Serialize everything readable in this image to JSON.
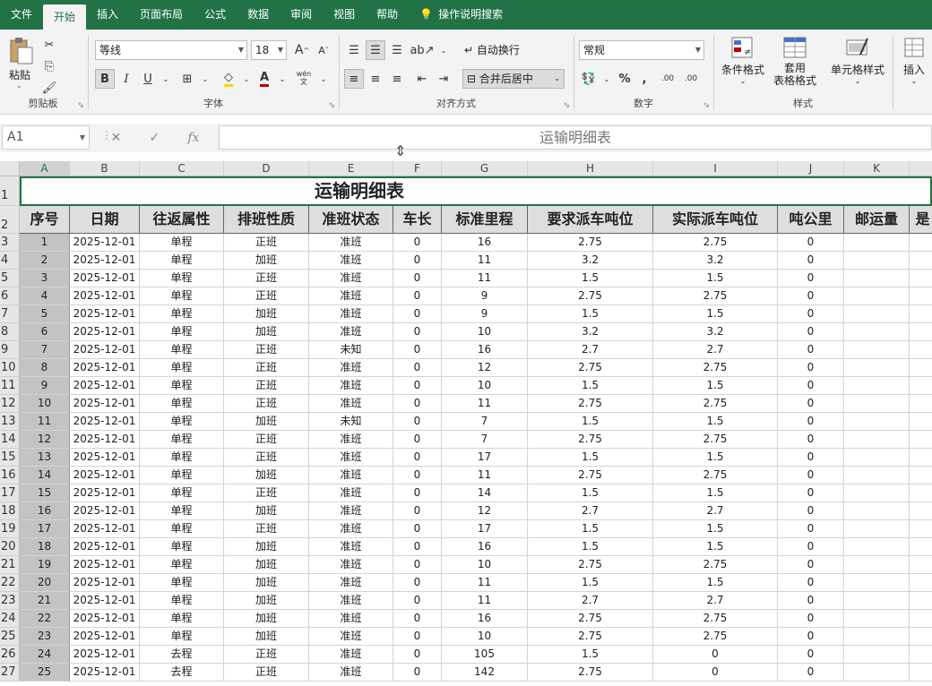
{
  "tabs": [
    "文件",
    "开始",
    "插入",
    "页面布局",
    "公式",
    "数据",
    "审阅",
    "视图",
    "帮助"
  ],
  "active_tab": "开始",
  "tell_me": "操作说明搜索",
  "ribbon": {
    "clipboard": {
      "paste": "粘贴",
      "label": "剪贴板"
    },
    "font": {
      "name": "等线",
      "size": "18",
      "label": "字体",
      "bold": "B",
      "italic": "I",
      "underline": "U",
      "grow": "A",
      "shrink": "A",
      "phonetic": "wén\n文"
    },
    "align": {
      "wrap": "自动换行",
      "merge": "合并后居中",
      "label": "对齐方式"
    },
    "number": {
      "format": "常规",
      "label": "数字",
      "dec_inc": ".00",
      "dec_dec": ".00"
    },
    "styles": {
      "conditional": "条件格式",
      "table_l1": "套用",
      "table_l2": "表格格式",
      "cell": "单元格样式",
      "label": "样式"
    },
    "cells": {
      "insert": "插入"
    }
  },
  "formula_bar": {
    "name_box": "A1",
    "fx": "fx",
    "content": "运输明细表"
  },
  "columns": [
    "A",
    "B",
    "C",
    "D",
    "E",
    "F",
    "G",
    "H",
    "I",
    "J",
    "K"
  ],
  "row_numbers": [
    "1",
    "2",
    "3",
    "4",
    "5",
    "6",
    "7",
    "8",
    "9",
    "10",
    "11",
    "12",
    "13",
    "14",
    "15",
    "16",
    "17",
    "18",
    "19",
    "20",
    "21",
    "22",
    "23",
    "24",
    "25",
    "26",
    "27"
  ],
  "sheet_title": "运输明细表",
  "headers": [
    "序号",
    "日期",
    "往返属性",
    "排班性质",
    "准班状态",
    "车长",
    "标准里程",
    "要求派车吨位",
    "实际派车吨位",
    "吨公里",
    "邮运量",
    "是"
  ],
  "rows": [
    [
      "1",
      "2025-12-01",
      "单程",
      "正班",
      "准班",
      "0",
      "16",
      "2.75",
      "2.75",
      "0"
    ],
    [
      "2",
      "2025-12-01",
      "单程",
      "加班",
      "准班",
      "0",
      "11",
      "3.2",
      "3.2",
      "0"
    ],
    [
      "3",
      "2025-12-01",
      "单程",
      "正班",
      "准班",
      "0",
      "11",
      "1.5",
      "1.5",
      "0"
    ],
    [
      "4",
      "2025-12-01",
      "单程",
      "正班",
      "准班",
      "0",
      "9",
      "2.75",
      "2.75",
      "0"
    ],
    [
      "5",
      "2025-12-01",
      "单程",
      "加班",
      "准班",
      "0",
      "9",
      "1.5",
      "1.5",
      "0"
    ],
    [
      "6",
      "2025-12-01",
      "单程",
      "加班",
      "准班",
      "0",
      "10",
      "3.2",
      "3.2",
      "0"
    ],
    [
      "7",
      "2025-12-01",
      "单程",
      "正班",
      "未知",
      "0",
      "16",
      "2.7",
      "2.7",
      "0"
    ],
    [
      "8",
      "2025-12-01",
      "单程",
      "正班",
      "准班",
      "0",
      "12",
      "2.75",
      "2.75",
      "0"
    ],
    [
      "9",
      "2025-12-01",
      "单程",
      "正班",
      "准班",
      "0",
      "10",
      "1.5",
      "1.5",
      "0"
    ],
    [
      "10",
      "2025-12-01",
      "单程",
      "正班",
      "准班",
      "0",
      "11",
      "2.75",
      "2.75",
      "0"
    ],
    [
      "11",
      "2025-12-01",
      "单程",
      "加班",
      "未知",
      "0",
      "7",
      "1.5",
      "1.5",
      "0"
    ],
    [
      "12",
      "2025-12-01",
      "单程",
      "正班",
      "准班",
      "0",
      "7",
      "2.75",
      "2.75",
      "0"
    ],
    [
      "13",
      "2025-12-01",
      "单程",
      "正班",
      "准班",
      "0",
      "17",
      "1.5",
      "1.5",
      "0"
    ],
    [
      "14",
      "2025-12-01",
      "单程",
      "加班",
      "准班",
      "0",
      "11",
      "2.75",
      "2.75",
      "0"
    ],
    [
      "15",
      "2025-12-01",
      "单程",
      "正班",
      "准班",
      "0",
      "14",
      "1.5",
      "1.5",
      "0"
    ],
    [
      "16",
      "2025-12-01",
      "单程",
      "加班",
      "准班",
      "0",
      "12",
      "2.7",
      "2.7",
      "0"
    ],
    [
      "17",
      "2025-12-01",
      "单程",
      "正班",
      "准班",
      "0",
      "17",
      "1.5",
      "1.5",
      "0"
    ],
    [
      "18",
      "2025-12-01",
      "单程",
      "加班",
      "准班",
      "0",
      "16",
      "1.5",
      "1.5",
      "0"
    ],
    [
      "19",
      "2025-12-01",
      "单程",
      "加班",
      "准班",
      "0",
      "10",
      "2.75",
      "2.75",
      "0"
    ],
    [
      "20",
      "2025-12-01",
      "单程",
      "加班",
      "准班",
      "0",
      "11",
      "1.5",
      "1.5",
      "0"
    ],
    [
      "21",
      "2025-12-01",
      "单程",
      "加班",
      "准班",
      "0",
      "11",
      "2.7",
      "2.7",
      "0"
    ],
    [
      "22",
      "2025-12-01",
      "单程",
      "加班",
      "准班",
      "0",
      "16",
      "2.75",
      "2.75",
      "0"
    ],
    [
      "23",
      "2025-12-01",
      "单程",
      "加班",
      "准班",
      "0",
      "10",
      "2.75",
      "2.75",
      "0"
    ],
    [
      "24",
      "2025-12-01",
      "去程",
      "正班",
      "准班",
      "0",
      "105",
      "1.5",
      "0",
      "0"
    ],
    [
      "25",
      "2025-12-01",
      "去程",
      "正班",
      "准班",
      "0",
      "142",
      "2.75",
      "0",
      "0"
    ]
  ],
  "colors": {
    "brand": "#217346",
    "header_fill": "#dedede",
    "seq_fill": "#c3c3c3"
  }
}
